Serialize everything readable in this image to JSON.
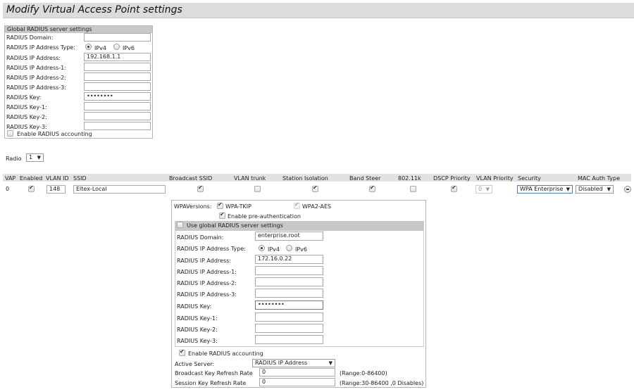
{
  "page_title": "Modify Virtual Access Point settings",
  "global_radius": {
    "header": "Global RADIUS server settings",
    "domain_label": "RADIUS Domain:",
    "domain_value": "",
    "ip_type_label": "RADIUS IP Address Type:",
    "ipv4_label": "IPv4",
    "ipv6_label": "IPv6",
    "ip_type_selected": "IPv4",
    "ip_label": "RADIUS IP Address:",
    "ip_value": "192.168.1.1",
    "ip1_label": "RADIUS IP Address-1:",
    "ip1_value": "",
    "ip2_label": "RADIUS IP Address-2:",
    "ip2_value": "",
    "ip3_label": "RADIUS IP Address-3:",
    "ip3_value": "",
    "key_label": "RADIUS Key:",
    "key_value": "••••••••",
    "key1_label": "RADIUS Key-1:",
    "key1_value": "",
    "key2_label": "RADIUS Key-2:",
    "key2_value": "",
    "key3_label": "RADIUS Key-3:",
    "key3_value": "",
    "accounting_label": "Enable RADIUS accounting",
    "accounting_enabled": false
  },
  "radio": {
    "label": "Radio",
    "value": "1"
  },
  "vap_table": {
    "headers": {
      "vap": "VAP",
      "enabled": "Enabled",
      "vlan_id": "VLAN ID",
      "ssid": "SSID",
      "broadcast_ssid": "Broadcast SSID",
      "vlan_trunk": "VLAN trunk",
      "station_isolation": "Station Isolation",
      "band_steer": "Band Steer",
      "dot11k": "802.11k",
      "dscp_priority": "DSCP Priority",
      "vlan_priority": "VLAN Priority",
      "security": "Security",
      "mac_auth_type": "MAC Auth Type"
    },
    "row": {
      "vap": "0",
      "enabled": true,
      "vlan_id": "148",
      "ssid": "Eltex-Local",
      "broadcast_ssid": true,
      "vlan_trunk": false,
      "station_isolation": true,
      "band_steer": true,
      "dot11k": false,
      "dscp_priority": true,
      "vlan_priority": "0",
      "security": "WPA Enterprise",
      "mac_auth_type": "Disabled"
    }
  },
  "security_panel": {
    "wpa_versions_label": "WPAVersions:",
    "wpa_tkip_label": "WPA-TKIP",
    "wpa_tkip": true,
    "wpa2_aes_label": "WPA2-AES",
    "wpa2_aes": true,
    "preauth_label": "Enable pre-authentication",
    "preauth": true,
    "use_global_label": "Use global RADIUS server settings",
    "use_global": false,
    "domain_label": "RADIUS Domain:",
    "domain_value": "enterprise.root",
    "ip_type_label": "RADIUS IP Address Type:",
    "ipv4_label": "IPv4",
    "ipv6_label": "IPv6",
    "ip_type_selected": "IPv4",
    "ip_label": "RADIUS IP Address:",
    "ip_value": "172.16.0.22",
    "ip1_label": "RADIUS IP Address-1:",
    "ip1_value": "",
    "ip2_label": "RADIUS IP Address-2:",
    "ip2_value": "",
    "ip3_label": "RADIUS IP Address-3:",
    "ip3_value": "",
    "key_label": "RADIUS Key:",
    "key_value": "••••••••",
    "key1_label": "RADIUS Key-1:",
    "key1_value": "",
    "key2_label": "RADIUS Key-2:",
    "key2_value": "",
    "key3_label": "RADIUS Key-3:",
    "key3_value": "",
    "accounting_label": "Enable RADIUS accounting",
    "accounting": true,
    "active_server_label": "Active Server:",
    "active_server_value": "RADIUS IP Address",
    "broadcast_key_label": "Broadcast Key Refresh Rate",
    "broadcast_key_value": "0",
    "broadcast_key_range": "(Range:0-86400)",
    "session_key_label": "Session Key Refresh Rate",
    "session_key_value": "0",
    "session_key_range": "(Range:30-86400 ,0 Disables)"
  },
  "colors": {
    "title_bg": "#dcdcdc",
    "section_header_bg": "#c8c8c8",
    "focus_border": "#4a7fc1"
  }
}
